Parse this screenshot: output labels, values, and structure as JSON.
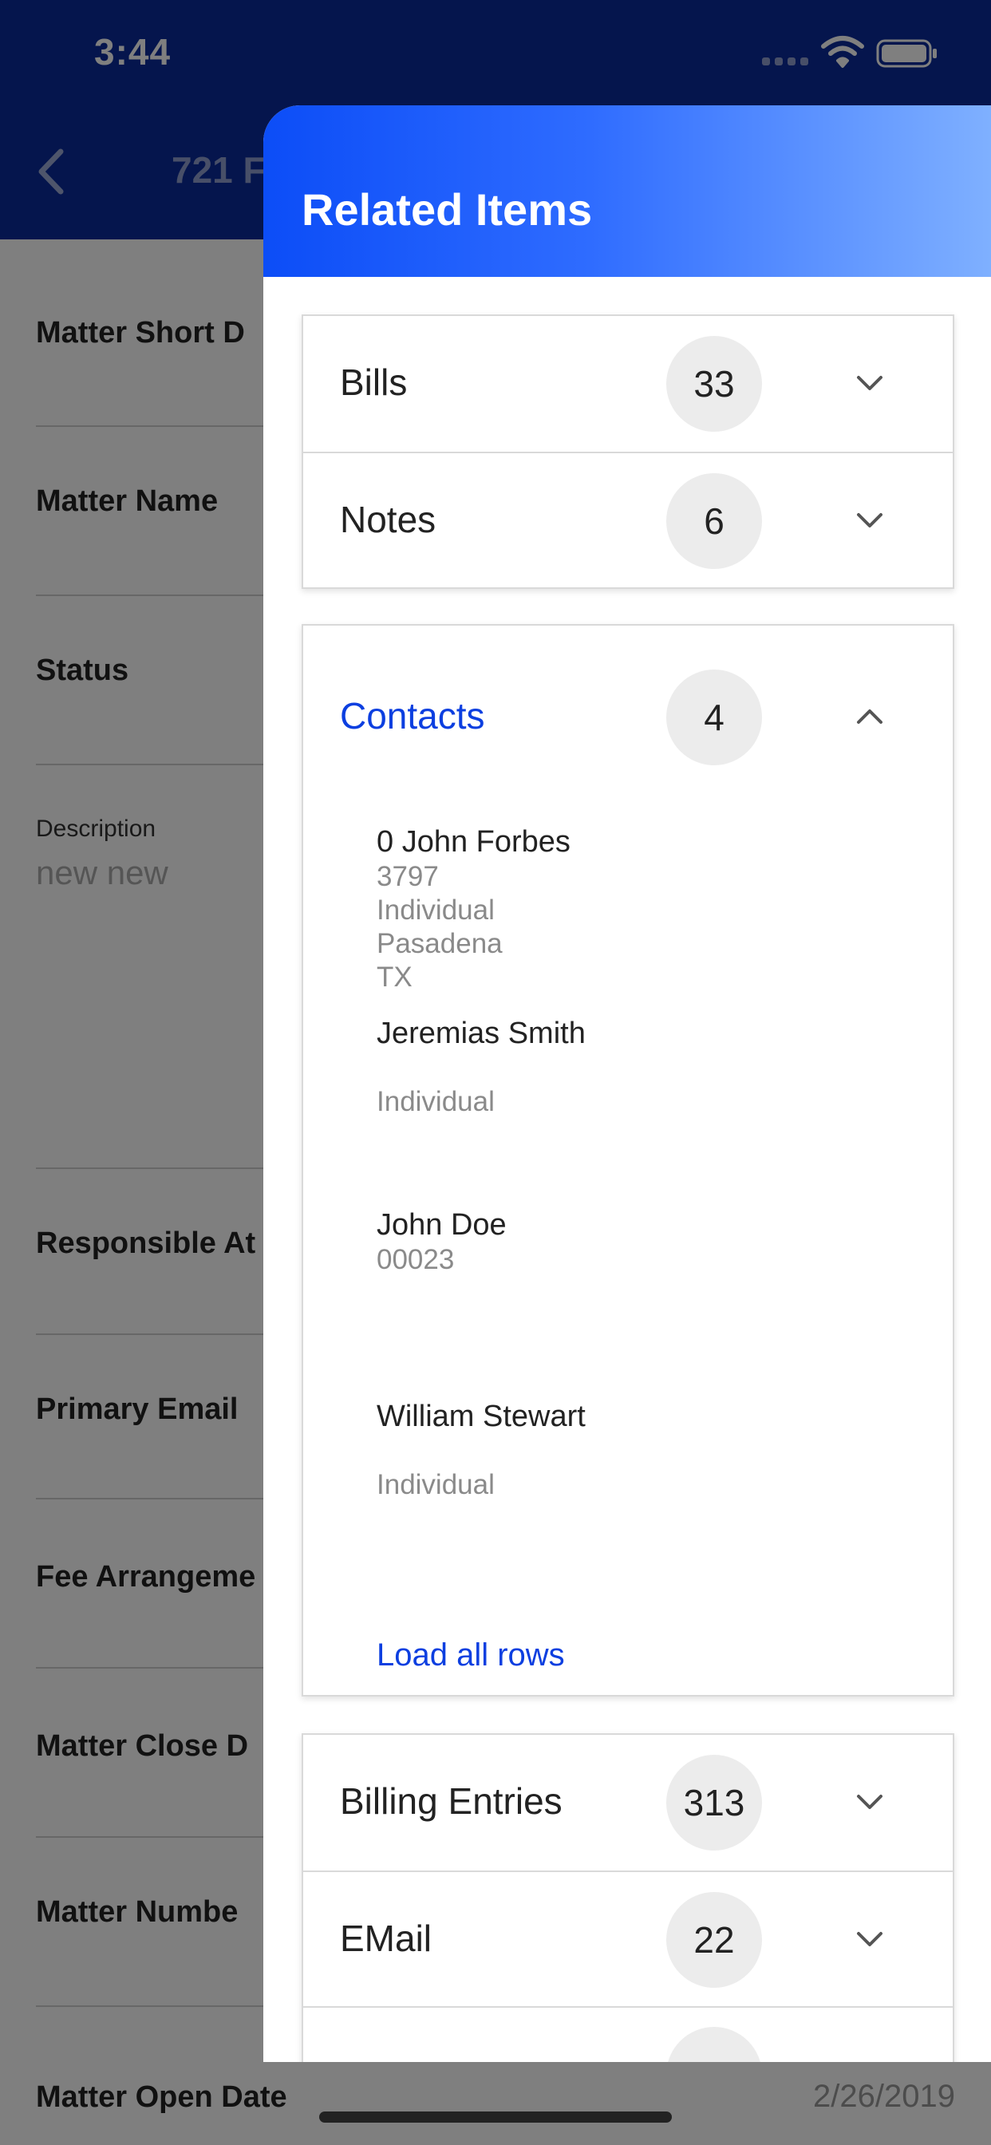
{
  "status_bar": {
    "time": "3:44"
  },
  "background_page": {
    "title": "721 F",
    "fields": [
      {
        "label": "Matter Short D",
        "value": ""
      },
      {
        "label": "Matter Name",
        "value": ""
      },
      {
        "label": "Status",
        "value": ""
      },
      {
        "label": "Responsible At",
        "value": ""
      },
      {
        "label": "Primary Email",
        "value": ""
      },
      {
        "label": "Fee Arrangeme",
        "value": ""
      },
      {
        "label": "Matter Close D",
        "value": ""
      },
      {
        "label": "Matter Numbe",
        "value": ""
      },
      {
        "label": "Matter Open Date",
        "value": "2/26/2019"
      }
    ],
    "description": {
      "label": "Description",
      "value": "new new"
    }
  },
  "drawer": {
    "title": "Related Items",
    "sections": [
      {
        "label": "Bills",
        "count": "33",
        "expanded": false
      },
      {
        "label": "Notes",
        "count": "6",
        "expanded": false
      },
      {
        "label": "Contacts",
        "count": "4",
        "expanded": true
      },
      {
        "label": "Billing Entries",
        "count": "313",
        "expanded": false
      },
      {
        "label": "EMail",
        "count": "22",
        "expanded": false
      }
    ],
    "contacts": [
      {
        "name": "0 John Forbes",
        "lines": [
          "3797",
          "Individual",
          "Pasadena",
          "TX"
        ]
      },
      {
        "name": "Jeremias Smith",
        "lines": [
          "",
          "Individual"
        ]
      },
      {
        "name": "John Doe",
        "lines": [
          "00023"
        ]
      },
      {
        "name": "William Stewart",
        "lines": [
          "",
          "Individual"
        ]
      }
    ],
    "load_all_label": "Load all rows"
  },
  "colors": {
    "header_dark": "#0a2b9a",
    "drawer_gradient_start": "#0c4df7",
    "drawer_gradient_end": "#7fb0ff",
    "accent": "#0c3fe0"
  }
}
